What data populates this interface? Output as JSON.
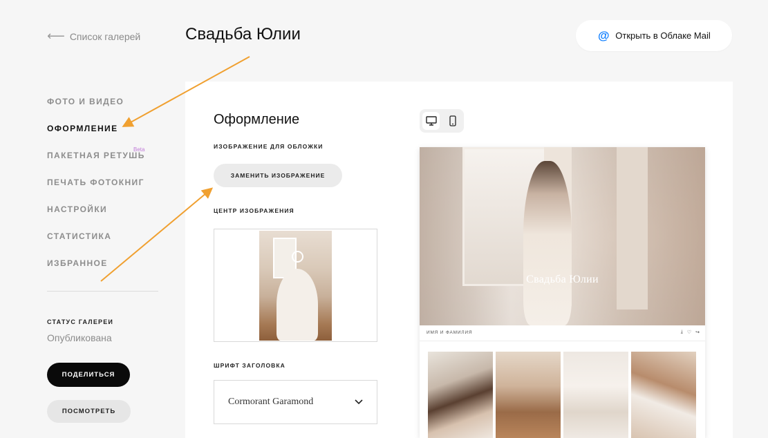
{
  "header": {
    "back_label": "Список галерей",
    "title": "Свадьба Юлии",
    "open_cloud_label": "Открыть в Облаке Mail"
  },
  "sidebar": {
    "items": [
      {
        "label": "ФОТО И ВИДЕО",
        "active": false
      },
      {
        "label": "ОФОРМЛЕНИЕ",
        "active": true
      },
      {
        "label": "ПАКЕТНАЯ РЕТУШЬ",
        "active": false,
        "badge": "Beta"
      },
      {
        "label": "ПЕЧАТЬ ФОТОКНИГ",
        "active": false
      },
      {
        "label": "НАСТРОЙКИ",
        "active": false
      },
      {
        "label": "СТАТИСТИКА",
        "active": false
      },
      {
        "label": "ИЗБРАННОЕ",
        "active": false
      }
    ],
    "status_label": "СТАТУС ГАЛЕРЕИ",
    "status_value": "Опубликована",
    "share_label": "ПОДЕЛИТЬСЯ",
    "view_label": "ПОСМОТРЕТЬ"
  },
  "design": {
    "heading": "Оформление",
    "cover_label": "ИЗОБРАЖЕНИЕ ДЛЯ ОБЛОЖКИ",
    "replace_label": "ЗАМЕНИТЬ ИЗОБРАЖЕНИЕ",
    "center_label": "ЦЕНТР ИЗОБРАЖЕНИЯ",
    "font_label": "ШРИФТ ЗАГОЛОВКА",
    "font_value": "Cormorant Garamond"
  },
  "preview": {
    "device_selected": "desktop",
    "cover_title": "Свадьба Юлии",
    "name_placeholder": "ИМЯ И ФАМИЛИЯ"
  },
  "colors": {
    "annotation_arrow": "#f0a030",
    "accent": "#0a7cff",
    "beta": "#c07bd8"
  }
}
